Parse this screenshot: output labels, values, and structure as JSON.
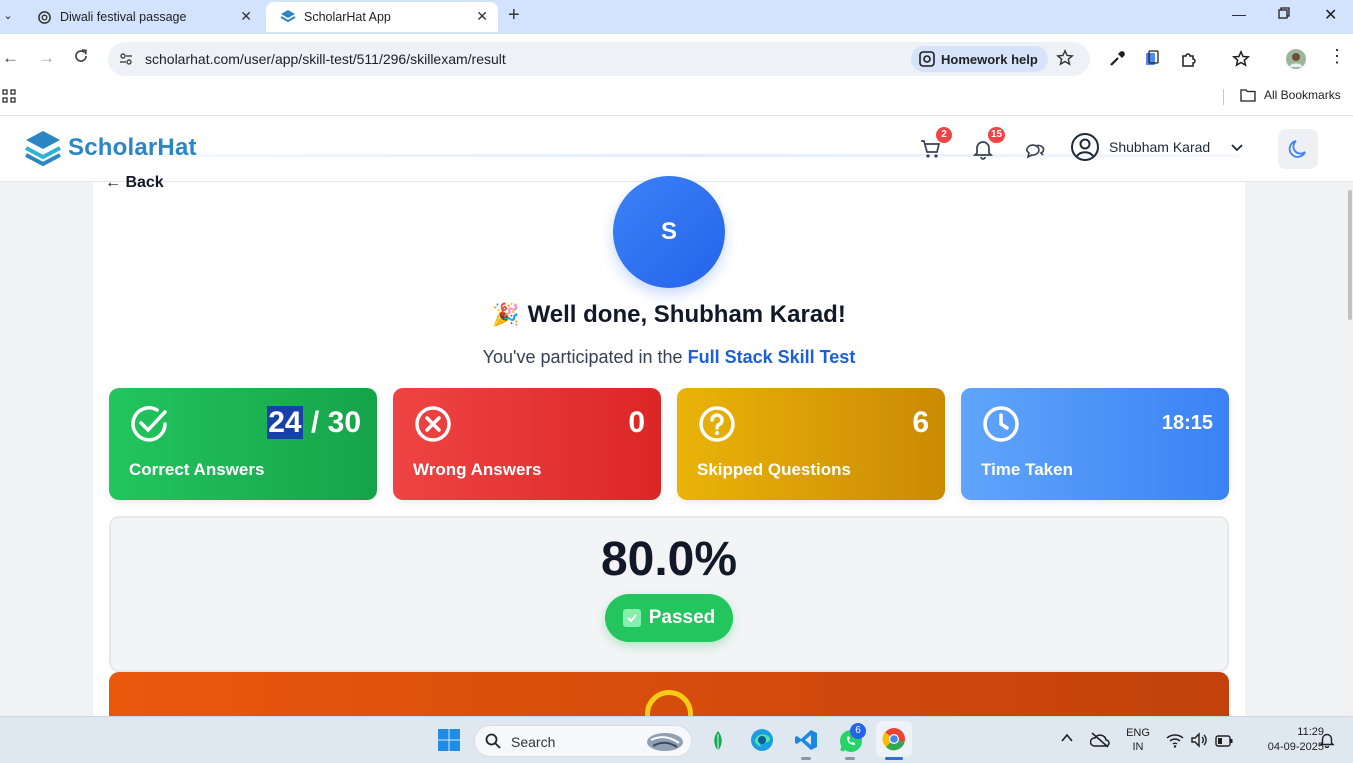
{
  "browser": {
    "tabs": [
      {
        "title": "Diwali festival passage",
        "icon": "openai-icon"
      },
      {
        "title": "ScholarHat App",
        "icon": "scholarhat-icon",
        "active": true
      }
    ],
    "url": "scholarhat.com/user/app/skill-test/511/296/skillexam/result",
    "homework_help": "Homework help",
    "all_bookmarks": "All Bookmarks"
  },
  "header": {
    "brand": "ScholarHat",
    "cart_count": "2",
    "notification_count": "15",
    "user_name": "Shubham Karad"
  },
  "result": {
    "back_label": "← Back",
    "avatar_initial": "S",
    "party_emoji": "🎉",
    "greeting": "Well done, Shubham Karad!",
    "participated_prefix": "You've participated in the",
    "test_name": "Full Stack Skill Test",
    "cards": {
      "correct": {
        "value_highlight": "24",
        "value_rest": " / 30",
        "label": "Correct Answers"
      },
      "wrong": {
        "value": "0",
        "label": "Wrong Answers"
      },
      "skipped": {
        "value": "6",
        "label": "Skipped Questions"
      },
      "time": {
        "value": "18:15",
        "label": "Time Taken"
      }
    },
    "percentage": "80.0%",
    "status": "Passed"
  },
  "colors": {
    "correct": "#22c55e",
    "wrong": "#ef4444",
    "skipped": "#eab308",
    "time": "#3b82f6",
    "brand": "#2b86c5",
    "link": "#1d5fd6"
  },
  "taskbar": {
    "search_placeholder": "Search",
    "whatsapp_badge": "6",
    "lang_top": "ENG",
    "lang_bottom": "IN",
    "time": "11:29",
    "date": "04-09-2025"
  }
}
